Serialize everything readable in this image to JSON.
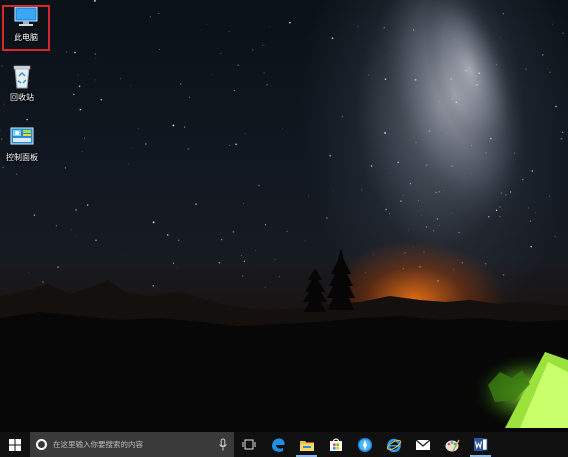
{
  "desktop": {
    "icons": [
      {
        "label": "此电脑",
        "icon": "this-pc-icon",
        "selected": true
      },
      {
        "label": "回收站",
        "icon": "recycle-bin-icon",
        "selected": false
      },
      {
        "label": "控制面板",
        "icon": "control-panel-icon",
        "selected": false
      }
    ]
  },
  "taskbar": {
    "search": {
      "placeholder": "在这里输入你要搜索的内容"
    },
    "apps": [
      {
        "name": "task-view",
        "icon": "task-view-icon"
      },
      {
        "name": "edge",
        "icon": "edge-icon"
      },
      {
        "name": "file-explorer",
        "icon": "file-explorer-icon"
      },
      {
        "name": "store",
        "icon": "store-icon"
      },
      {
        "name": "browser",
        "icon": "browser-icon"
      },
      {
        "name": "internet-explorer",
        "icon": "internet-explorer-icon"
      },
      {
        "name": "mail",
        "icon": "mail-icon"
      },
      {
        "name": "paint",
        "icon": "paint-icon"
      },
      {
        "name": "word",
        "icon": "word-icon"
      }
    ]
  },
  "colors": {
    "selection_border": "#d8262b",
    "taskbar_bg": "#101010",
    "search_bg": "#3a3a3a",
    "accent_blue": "#1e90e6"
  }
}
